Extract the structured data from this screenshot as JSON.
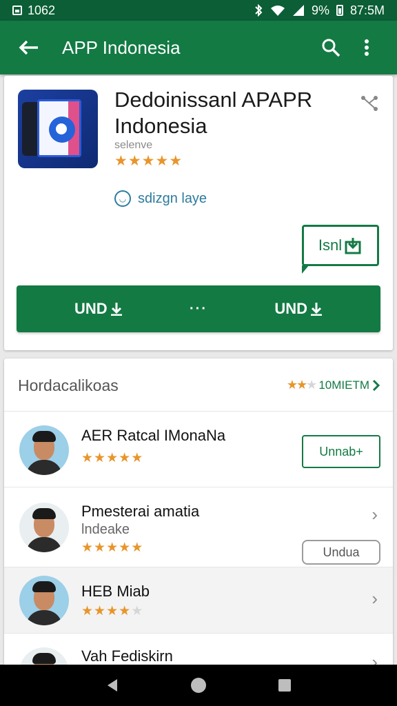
{
  "status_bar": {
    "time_left": "1062",
    "battery": "9%",
    "clock": "87:5M"
  },
  "app_bar": {
    "title": "APP Indonesia",
    "icons": [
      "back-arrow-icon",
      "search-icon",
      "more-vert-icon"
    ]
  },
  "app_card": {
    "name": "Dedoinissanl APAPR Indonesia",
    "subtitle": "selenve",
    "rating": 4.5,
    "feature_text": "sdizgn laye",
    "badge_text": "Isnl",
    "actions": {
      "left_label": "UND",
      "middle_label": "···",
      "right_label": "UND"
    }
  },
  "list_card": {
    "heading": "Hordacalikoas",
    "more_label": "10MIETM",
    "items": [
      {
        "title": "AER Ratcal IMonaNa",
        "subtitle": "",
        "rating": 5,
        "action": "Unnab+"
      },
      {
        "title": "Pmesterai amatia",
        "subtitle": "lndeake",
        "rating": 5,
        "action": "Undua"
      },
      {
        "title": "HEB Miab",
        "subtitle": "",
        "rating": 3.5,
        "action": ""
      },
      {
        "title": "Vah Fediskirn",
        "subtitle": "",
        "rating": 0,
        "action": ""
      }
    ]
  },
  "colors": {
    "primary": "#137a44",
    "primary_dark": "#0b5e35",
    "star": "#e8952b"
  }
}
